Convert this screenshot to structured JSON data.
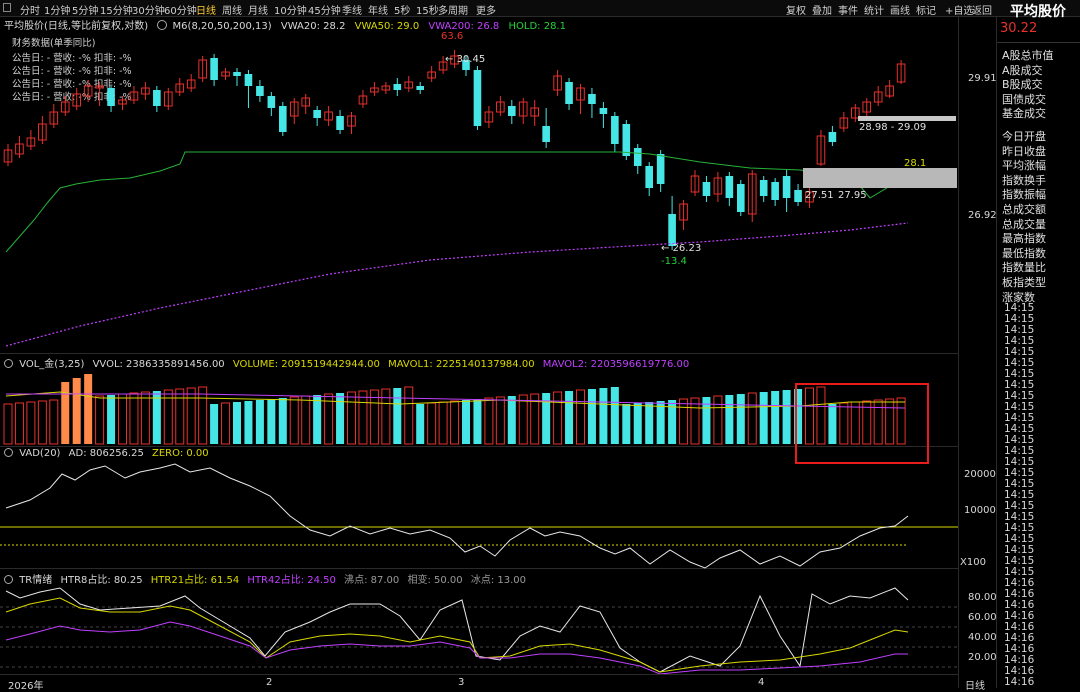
{
  "toolbar": {
    "periods": [
      "分时",
      "1分钟",
      "5分钟",
      "15分钟",
      "30分钟",
      "60分钟",
      "日线",
      "周线",
      "月线",
      "10分钟",
      "45分钟",
      "季线",
      "年线",
      "5秒",
      "15秒",
      "多周期",
      "更多"
    ],
    "active_period": "日线",
    "right_tools": [
      "复权",
      "叠加",
      "事件",
      "统计",
      "画线",
      "标记",
      "+自选",
      "返回"
    ]
  },
  "main_chart": {
    "title": "平均股价(日线,等比前复权,对数)",
    "indicator_name": "M6(8,20,50,200,13)",
    "vwa20": "VWA20: 28.2",
    "vwa50": "VWA50: 29.0",
    "vwa200": "VWA200: 26.8",
    "hold": "HOLD: 28.1",
    "finance_title": "财务数据(单季同比)",
    "finance_rows": [
      "公告日: -   营收: -%   扣非: -%",
      "公告日: -   营收: -%   扣非: -%",
      "公告日: -   营收: -%   扣非: -%",
      "公告日: -   营收: -%   扣非: -%"
    ],
    "annotations": {
      "high_pct": "63.6",
      "high_price": "30.45",
      "low_price": "26.23",
      "low_pct": "-13.4",
      "zone_upper": "28.98 - 29.09",
      "zone_lower_a": "27.51",
      "zone_lower_b": "27.95",
      "hold_label": "28.1"
    },
    "y_axis": [
      "29.91",
      "26.92"
    ]
  },
  "vol_panel": {
    "label": "VOL_金(3,25)",
    "vvol": "VVOL: 2386335891456.00",
    "volume": "VOLUME: 2091519442944.00",
    "mavol1": "MAVOL1: 2225140137984.00",
    "mavol2": "MAVOL2: 2203596619776.00"
  },
  "vad_panel": {
    "label": "VAD(20)",
    "ad": "AD: 806256.25",
    "zero": "ZERO: 0.00",
    "y_axis": [
      "20000",
      "10000"
    ],
    "unit": "X100"
  },
  "tr_panel": {
    "label": "TR情绪",
    "htr8": "HTR8占比: 80.25",
    "htr21": "HTR21占比: 61.54",
    "htr42": "HTR42占比: 24.50",
    "boil": "沸点: 87.00",
    "neutral": "相变: 50.00",
    "freeze": "冰点: 13.00",
    "y_axis": [
      "80.00",
      "60.00",
      "40.00",
      "20.00"
    ]
  },
  "x_axis": {
    "labels": [
      "2026年",
      "2",
      "3",
      "4"
    ],
    "period_label": "日线"
  },
  "right_panel": {
    "title": "平均股价",
    "price": "30.22",
    "items": [
      "A股总市值",
      "A股成交",
      "B股成交",
      "国债成交",
      "基金成交",
      "今日开盘",
      "昨日收盘",
      "平均涨幅",
      "指数换手",
      "指数振幅",
      "总成交额",
      "总成交量",
      "最高指数",
      "最低指数",
      "指数量比",
      "板指类型",
      "涨家数"
    ],
    "times": [
      "14:15",
      "14:15",
      "14:15",
      "14:15",
      "14:15",
      "14:15",
      "14:15",
      "14:15",
      "14:15",
      "14:15",
      "14:15",
      "14:15",
      "14:15",
      "14:15",
      "14:15",
      "14:15",
      "14:15",
      "14:15",
      "14:15",
      "14:15",
      "14:15",
      "14:15",
      "14:15",
      "14:15",
      "14:15",
      "14:16",
      "14:16",
      "14:16",
      "14:16",
      "14:16",
      "14:16",
      "14:16",
      "14:16",
      "14:16",
      "14:16"
    ]
  },
  "colors": {
    "up": "#e8312b",
    "down": "#46e6e6",
    "vwa20": "#27b238",
    "vwa50": "#d8d800",
    "vwa200": "#c040ff",
    "highlight_box": "#e81c1c",
    "active": "#ffcc33"
  }
}
